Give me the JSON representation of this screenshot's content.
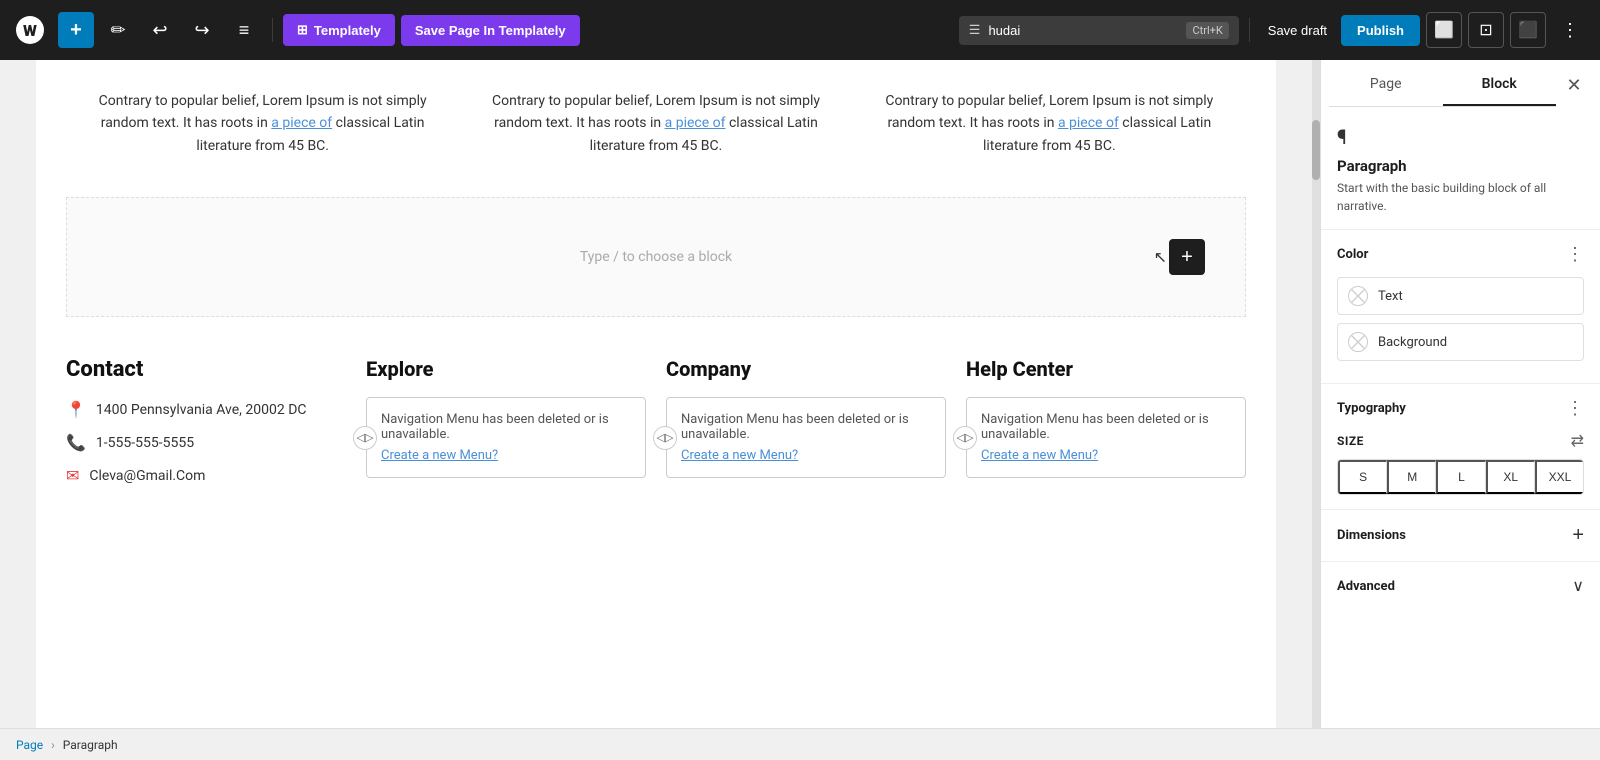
{
  "toolbar": {
    "wp_logo": "W",
    "add_label": "+",
    "edit_label": "✎",
    "undo_label": "↩",
    "redo_label": "↪",
    "tools_label": "≡",
    "templately_label": "Templately",
    "save_templately_label": "Save Page In Templately",
    "search_placeholder": "hudai",
    "shortcut": "Ctrl+K",
    "save_draft_label": "Save draft",
    "publish_label": "Publish",
    "preview_icon": "⬜",
    "settings_icon": "⚙"
  },
  "canvas": {
    "text_columns": [
      {
        "text_before": "Contrary to popular belief, Lorem Ipsum is not simply random text. It has roots in ",
        "link_text": "a piece of",
        "text_after": " classical Latin literature from 45 BC."
      },
      {
        "text_before": "Contrary to popular belief, Lorem Ipsum is not simply random text. It has roots in ",
        "link_text": "a piece of",
        "text_after": " classical Latin literature from 45 BC."
      },
      {
        "text_before": "Contrary to popular belief, Lorem Ipsum is not simply random text. It has roots in ",
        "link_text": "a piece of",
        "text_after": " classical Latin literature from 45 BC."
      }
    ],
    "empty_block_placeholder": "Type / to choose a block",
    "add_block_label": "+",
    "footer": {
      "contact": {
        "title": "Contact",
        "address": "1400 Pennsylvania Ave, 20002 DC",
        "phone": "1-555-555-5555",
        "email": "Cleva@Gmail.Com"
      },
      "explore": {
        "title": "Explore",
        "menu_deleted": "Navigation Menu has been deleted or is unavailable.",
        "create_menu": "Create a new Menu?"
      },
      "company": {
        "title": "Company",
        "menu_deleted": "Navigation Menu has been deleted or is unavailable.",
        "create_menu": "Create a new Menu?"
      },
      "help_center": {
        "title": "Help Center",
        "menu_deleted": "Navigation Menu has been deleted or is unavailable.",
        "create_menu": "Create a new Menu?"
      }
    }
  },
  "sidebar": {
    "page_tab": "Page",
    "block_tab": "Block",
    "close_label": "✕",
    "block_icon": "¶",
    "block_title": "Paragraph",
    "block_description": "Start with the basic building block of all narrative.",
    "color_section_title": "Color",
    "color_menu_icon": "⋮",
    "text_color_label": "Text",
    "background_color_label": "Background",
    "typography_section_title": "Typography",
    "typography_menu_icon": "⋮",
    "size_label": "SIZE",
    "reset_icon": "⇄",
    "size_options": [
      "S",
      "M",
      "L",
      "XL",
      "XXL"
    ],
    "dimensions_title": "Dimensions",
    "dimensions_add_icon": "+",
    "advanced_title": "Advanced",
    "advanced_chevron": "∨"
  },
  "breadcrumb": {
    "page_label": "Page",
    "separator": "›",
    "current": "Paragraph"
  }
}
